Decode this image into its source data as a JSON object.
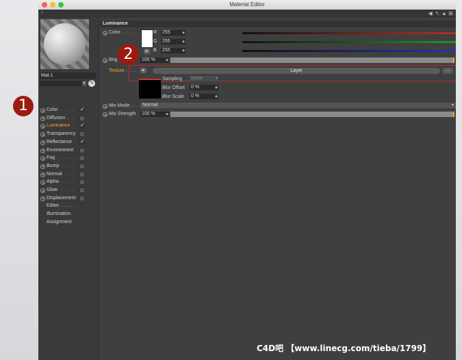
{
  "window": {
    "title": "Material Editor"
  },
  "toolbar": {
    "icons": [
      "grip-icon",
      "back-arrow-icon",
      "cursor-icon",
      "lock-icon",
      "expand-icon"
    ]
  },
  "material": {
    "name": "Mat.1"
  },
  "channels": [
    {
      "label": "Color",
      "checked": true,
      "active": false,
      "dots": ". . . . . ."
    },
    {
      "label": "Diffusion",
      "checked": false,
      "active": false,
      "dots": ". . . ."
    },
    {
      "label": "Luminance",
      "checked": true,
      "active": true,
      "dots": ". ."
    },
    {
      "label": "Transparency",
      "checked": false,
      "active": false,
      "dots": ""
    },
    {
      "label": "Reflectance",
      "checked": true,
      "active": false,
      "dots": ". ."
    },
    {
      "label": "Environment",
      "checked": false,
      "active": false,
      "dots": ""
    },
    {
      "label": "Fog",
      "checked": false,
      "active": false,
      "dots": ". . . . . . . . ."
    },
    {
      "label": "Bump",
      "checked": false,
      "active": false,
      "dots": ". . . . . ."
    },
    {
      "label": "Normal",
      "checked": false,
      "active": false,
      "dots": ". . . . ."
    },
    {
      "label": "Alpha",
      "checked": false,
      "active": false,
      "dots": ". . . . . ."
    },
    {
      "label": "Glow",
      "checked": false,
      "active": false,
      "dots": ". . . . . . ."
    },
    {
      "label": "Displacement",
      "checked": false,
      "active": false,
      "dots": ""
    }
  ],
  "extra_items": [
    {
      "label": "Editor . . . . . ."
    },
    {
      "label": "Illumination"
    },
    {
      "label": "Assignment"
    }
  ],
  "luminance": {
    "heading": "Luminance",
    "color_label": "Color . . . .",
    "r_label": "R",
    "r_value": "255",
    "g_label": "G",
    "g_value": "255",
    "b_label": "B",
    "b_value": "255",
    "brightness_label": "Brig",
    "brightness_value": "100 %",
    "texture_label": "Texture . . . .",
    "layer_label": "Layer",
    "more_button": "...",
    "sampling_label": "Sampling",
    "sampling_value": "None",
    "blur_offset_label": "Blur Offset",
    "blur_offset_value": "0 %",
    "blur_scale_label": "Blur Scale",
    "blur_scale_value": "0 %",
    "mix_mode_label": "Mix Mode . .",
    "mix_mode_value": "Normal",
    "mix_strength_label": "Mix Strength",
    "mix_strength_value": "100 %",
    "mix_strength_fraction": 1.0
  },
  "colors": {
    "red": "#d83a2b",
    "green": "#26b13a",
    "blue": "#2b3bd8",
    "accent": "#f6a623",
    "marker": "#9b1b12"
  },
  "markers": {
    "one": "1",
    "two": "2"
  },
  "watermark": "C4D吧 【www.linecg.com/tieba/1799】"
}
